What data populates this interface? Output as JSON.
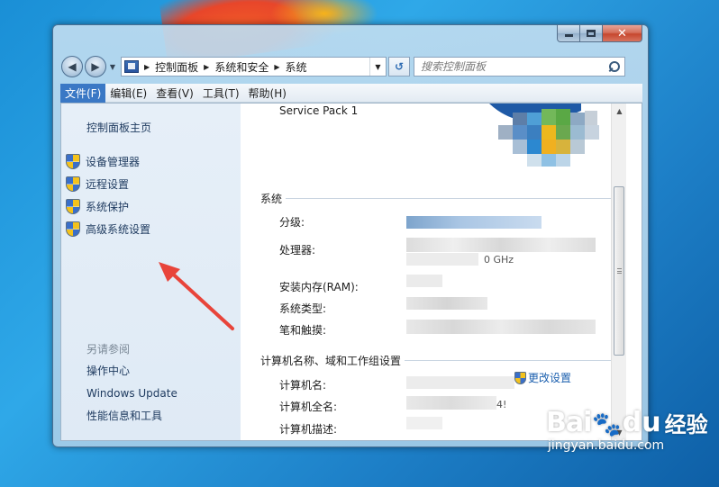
{
  "window": {
    "caption_buttons": {
      "minimize": "minimize",
      "maximize": "maximize",
      "close": "✕"
    }
  },
  "nav": {
    "back": "◀",
    "forward": "▶",
    "breadcrumb": [
      "控制面板",
      "系统和安全",
      "系统"
    ],
    "search_placeholder": "搜索控制面板"
  },
  "menu": {
    "items": [
      "文件(F)",
      "编辑(E)",
      "查看(V)",
      "工具(T)",
      "帮助(H)"
    ],
    "active_index": 0
  },
  "left_pane": {
    "home_link": "控制面板主页",
    "tasks": [
      "设备管理器",
      "远程设置",
      "系统保护",
      "高级系统设置"
    ],
    "see_also_title": "另请参阅",
    "see_also_links": [
      "操作中心",
      "Windows Update",
      "性能信息和工具"
    ]
  },
  "right_pane": {
    "service_pack": "Service Pack 1",
    "system_section": {
      "title": "系统",
      "rows": [
        "分级:",
        "处理器:",
        "安装内存(RAM):",
        "系统类型:",
        "笔和触摸:"
      ],
      "processor_fragment": "0 GHz"
    },
    "computer_section": {
      "title": "计算机名称、域和工作组设置",
      "rows": [
        "计算机名:",
        "计算机全名:",
        "计算机描述:"
      ],
      "fullname_fragment": "4!",
      "change_settings": "更改设置"
    }
  },
  "watermark": {
    "bai": "Bai",
    "du": "du",
    "jingyan": "经验",
    "url": "jingyan.baidu.com"
  },
  "colors": {
    "accent": "#3a78c5",
    "link": "#1b5fae",
    "annotation_arrow": "#e8443a"
  },
  "icons": {
    "window_icon": "control-panel-icon",
    "task_icon": "uac-shield-icon",
    "search": "search-icon",
    "refresh": "refresh-icon"
  }
}
